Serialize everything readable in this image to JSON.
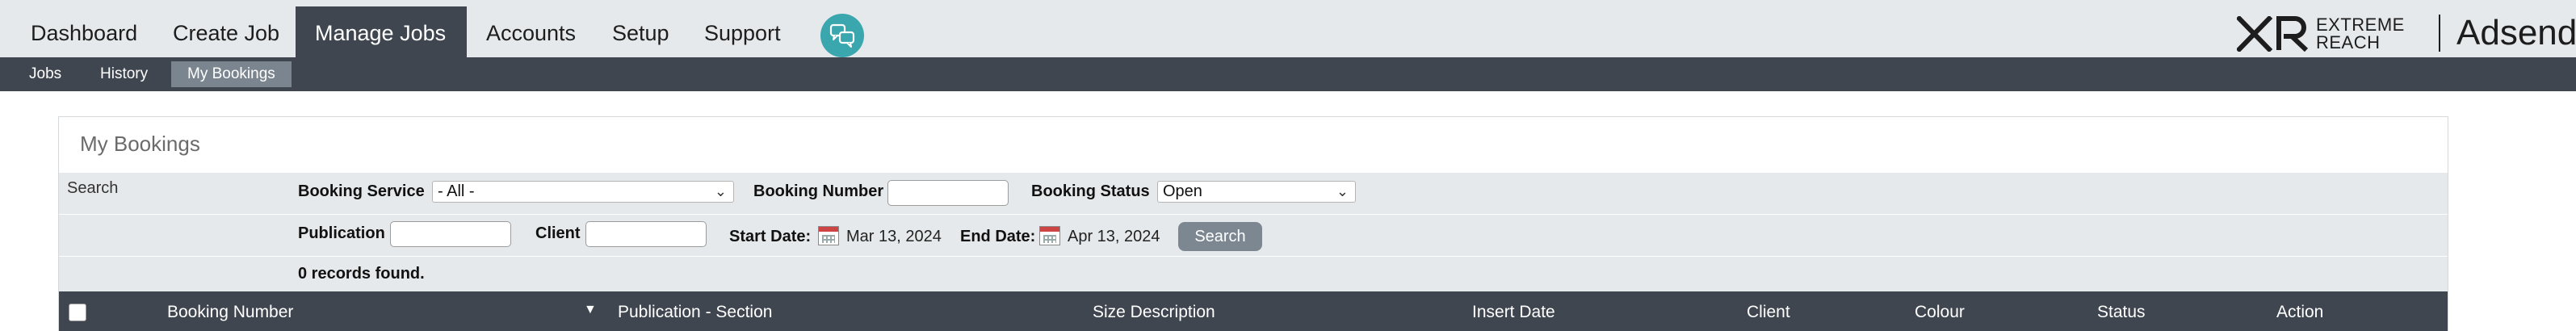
{
  "nav": {
    "items": [
      {
        "label": "Dashboard",
        "active": false
      },
      {
        "label": "Create Job",
        "active": false
      },
      {
        "label": "Manage Jobs",
        "active": true
      },
      {
        "label": "Accounts",
        "active": false
      },
      {
        "label": "Setup",
        "active": false
      },
      {
        "label": "Support",
        "active": false
      }
    ]
  },
  "brand": {
    "xr_line1": "EXTREME",
    "xr_line2": "REACH",
    "name": "Adsend"
  },
  "subnav": {
    "items": [
      {
        "label": "Jobs",
        "active": false
      },
      {
        "label": "History",
        "active": false
      },
      {
        "label": "My Bookings",
        "active": true
      }
    ]
  },
  "panel": {
    "title": "My Bookings",
    "search_label": "Search",
    "filters": {
      "booking_service_label": "Booking Service",
      "booking_service_value": "- All -",
      "booking_number_label": "Booking Number",
      "booking_number_value": "",
      "booking_status_label": "Booking Status",
      "booking_status_value": "Open",
      "publication_label": "Publication",
      "publication_value": "",
      "client_label": "Client",
      "client_value": "",
      "start_date_label": "Start Date:",
      "start_date_value": "Mar 13, 2024",
      "end_date_label": "End Date:",
      "end_date_value": "Apr 13, 2024",
      "search_button": "Search"
    },
    "records_text": "0 records found.",
    "table": {
      "columns": [
        "Booking Number",
        "Publication - Section",
        "Size Description",
        "Insert Date",
        "Client",
        "Colour",
        "Status",
        "Action"
      ]
    }
  },
  "colors": {
    "nav_bg": "#e6e9eb",
    "dark_bar": "#3f464f",
    "accent_teal": "#3aa6ae",
    "button_grey": "#7c8791"
  }
}
